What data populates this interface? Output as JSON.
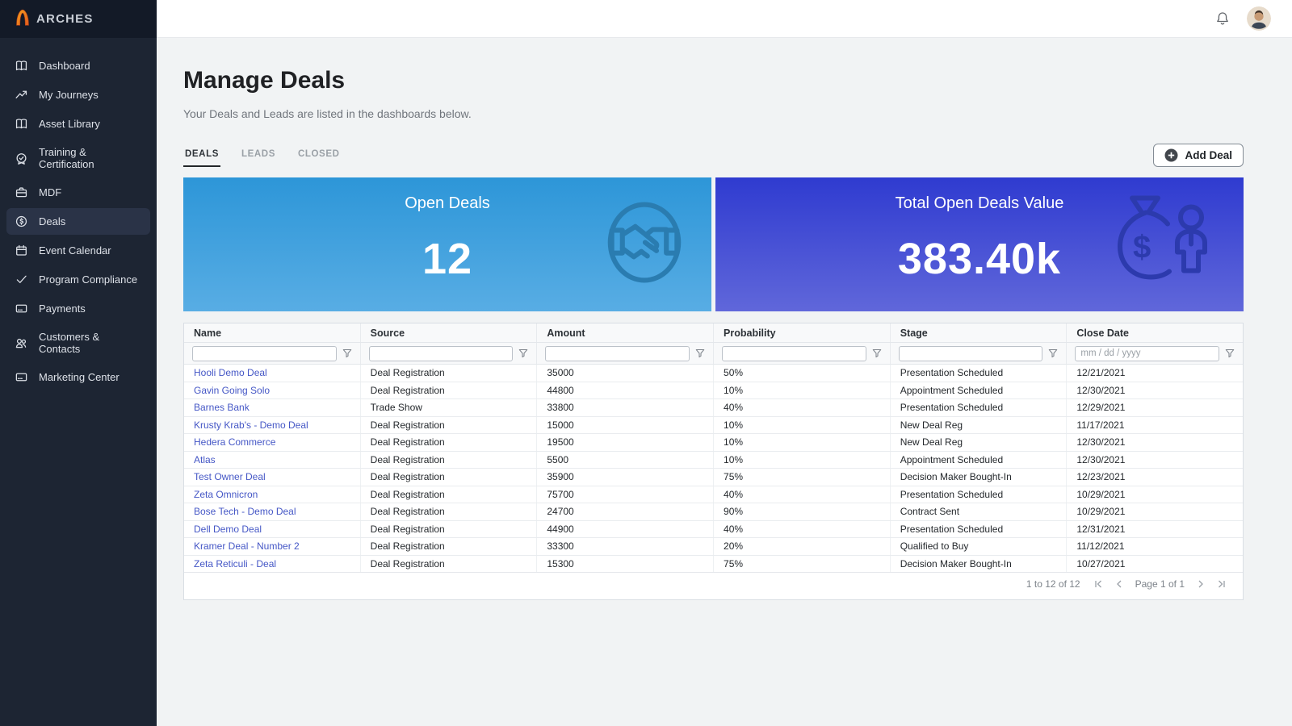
{
  "brand": {
    "name": "ARCHES",
    "logo_icon": "arch-icon"
  },
  "topbar": {
    "icons": [
      "bell-icon",
      "user-avatar"
    ]
  },
  "sidebar": {
    "bg_color": "#1d2533",
    "items": [
      {
        "label": "Dashboard",
        "icon": "book-icon",
        "active": false
      },
      {
        "label": "My Journeys",
        "icon": "trending-up-icon",
        "active": false
      },
      {
        "label": "Asset Library",
        "icon": "book-icon",
        "active": false
      },
      {
        "label": "Training & Certification",
        "icon": "badge-check-icon",
        "active": false
      },
      {
        "label": "MDF",
        "icon": "briefcase-icon",
        "active": false
      },
      {
        "label": "Deals",
        "icon": "dollar-circle-icon",
        "active": true
      },
      {
        "label": "Event Calendar",
        "icon": "calendar-icon",
        "active": false
      },
      {
        "label": "Program Compliance",
        "icon": "check-icon",
        "active": false
      },
      {
        "label": "Payments",
        "icon": "credit-card-icon",
        "active": false
      },
      {
        "label": "Customers & Contacts",
        "icon": "people-icon",
        "active": false
      },
      {
        "label": "Marketing Center",
        "icon": "credit-card-icon",
        "active": false
      }
    ]
  },
  "page": {
    "title": "Manage Deals",
    "subtitle": "Your Deals and Leads are listed in the dashboards below."
  },
  "tabs": [
    {
      "label": "DEALS",
      "active": true
    },
    {
      "label": "LEADS",
      "active": false
    },
    {
      "label": "CLOSED",
      "active": false
    }
  ],
  "toolbar": {
    "add_deal_label": "Add Deal",
    "add_icon": "plus-circle-icon"
  },
  "cards": [
    {
      "title": "Open Deals",
      "value": "12",
      "icon": "handshake-icon",
      "gradient_top": "#2D96D8",
      "gradient_bottom": "#58ADE4"
    },
    {
      "title": "Total Open Deals Value",
      "value": "383.40k",
      "icon": "money-bag-icon",
      "gradient_top": "#2F3BD0",
      "gradient_bottom": "#6067DA"
    }
  ],
  "table": {
    "link_color": "#4557c6",
    "columns": [
      {
        "key": "name",
        "label": "Name",
        "filter_placeholder": ""
      },
      {
        "key": "source",
        "label": "Source",
        "filter_placeholder": ""
      },
      {
        "key": "amount",
        "label": "Amount",
        "filter_placeholder": ""
      },
      {
        "key": "probability",
        "label": "Probability",
        "filter_placeholder": ""
      },
      {
        "key": "stage",
        "label": "Stage",
        "filter_placeholder": ""
      },
      {
        "key": "close_date",
        "label": "Close Date",
        "filter_placeholder": "mm / dd / yyyy"
      }
    ],
    "rows": [
      {
        "name": "Hooli Demo Deal",
        "source": "Deal Registration",
        "amount": "35000",
        "probability": "50%",
        "stage": "Presentation Scheduled",
        "close_date": "12/21/2021"
      },
      {
        "name": "Gavin Going Solo",
        "source": "Deal Registration",
        "amount": "44800",
        "probability": "10%",
        "stage": "Appointment Scheduled",
        "close_date": "12/30/2021"
      },
      {
        "name": "Barnes Bank",
        "source": "Trade Show",
        "amount": "33800",
        "probability": "40%",
        "stage": "Presentation Scheduled",
        "close_date": "12/29/2021"
      },
      {
        "name": "Krusty Krab's - Demo Deal",
        "source": "Deal Registration",
        "amount": "15000",
        "probability": "10%",
        "stage": "New Deal Reg",
        "close_date": "11/17/2021"
      },
      {
        "name": "Hedera Commerce",
        "source": "Deal Registration",
        "amount": "19500",
        "probability": "10%",
        "stage": "New Deal Reg",
        "close_date": "12/30/2021"
      },
      {
        "name": "Atlas",
        "source": "Deal Registration",
        "amount": "5500",
        "probability": "10%",
        "stage": "Appointment Scheduled",
        "close_date": "12/30/2021"
      },
      {
        "name": "Test Owner Deal",
        "source": "Deal Registration",
        "amount": "35900",
        "probability": "75%",
        "stage": "Decision Maker Bought-In",
        "close_date": "12/23/2021"
      },
      {
        "name": "Zeta Omnicron",
        "source": "Deal Registration",
        "amount": "75700",
        "probability": "40%",
        "stage": "Presentation Scheduled",
        "close_date": "10/29/2021"
      },
      {
        "name": "Bose Tech - Demo Deal",
        "source": "Deal Registration",
        "amount": "24700",
        "probability": "90%",
        "stage": "Contract Sent",
        "close_date": "10/29/2021"
      },
      {
        "name": "Dell Demo Deal",
        "source": "Deal Registration",
        "amount": "44900",
        "probability": "40%",
        "stage": "Presentation Scheduled",
        "close_date": "12/31/2021"
      },
      {
        "name": "Kramer Deal - Number 2",
        "source": "Deal Registration",
        "amount": "33300",
        "probability": "20%",
        "stage": "Qualified to Buy",
        "close_date": "11/12/2021"
      },
      {
        "name": "Zeta Reticuli - Deal",
        "source": "Deal Registration",
        "amount": "15300",
        "probability": "75%",
        "stage": "Decision Maker Bought-In",
        "close_date": "10/27/2021"
      }
    ],
    "pagination": {
      "range_text": "1 to 12 of 12",
      "page_text": "Page 1 of 1",
      "icons": [
        "first-page-icon",
        "prev-page-icon",
        "next-page-icon",
        "last-page-icon"
      ]
    }
  }
}
